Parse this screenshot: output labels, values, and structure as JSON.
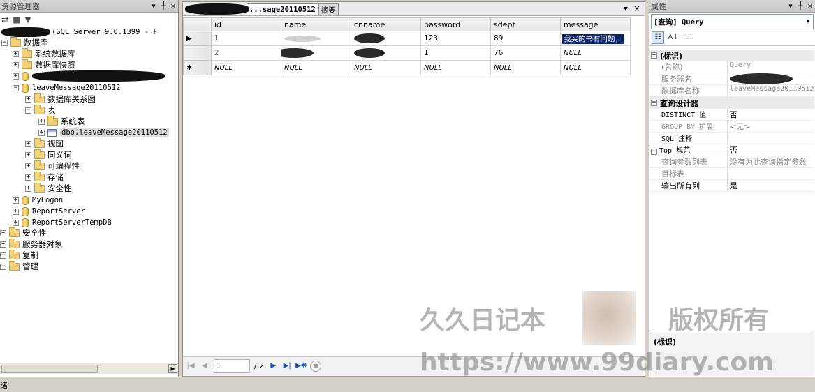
{
  "object_explorer": {
    "title": "资源管理器",
    "ctrl_pin": "▾ ╀",
    "ctrl_close": "×",
    "server_label": "(SQL Server 9.0.1399 - F",
    "tree": {
      "databases": "数据库",
      "system_databases": "系统数据库",
      "snapshots": "数据库快照",
      "db_main": "leaveMessage20110512",
      "diagrams": "数据库关系图",
      "tables": "表",
      "system_tables": "系统表",
      "table_item": "dbo.leaveMessage20110512",
      "views": "视图",
      "synonyms": "同义词",
      "programmability": "可编程性",
      "storage": "存储",
      "security_db": "安全性",
      "db_mylogon": "MyLogon",
      "db_reportserver": "ReportServer",
      "db_reportservertemp": "ReportServerTempDB",
      "security": "安全性",
      "server_objects": "服务器对象",
      "replication": "复制",
      "management": "管理"
    }
  },
  "query_window": {
    "tab_active": "...sage20110512",
    "tab_summary": "摘要",
    "columns": [
      "id",
      "name",
      "cnname",
      "password",
      "sdept",
      "message"
    ],
    "rows": [
      {
        "marker": "▶",
        "id": "1",
        "password": "123",
        "sdept": "89",
        "message": "我买的书有问题，"
      },
      {
        "marker": "",
        "id": "2",
        "password": "1",
        "sdept": "76",
        "message": "NULL"
      },
      {
        "marker": "✱",
        "id": "NULL",
        "name": "NULL",
        "cnname": "NULL",
        "password": "NULL",
        "sdept": "NULL",
        "message": "NULL"
      }
    ],
    "nav": {
      "page_value": "1",
      "page_total": "/ 2"
    }
  },
  "properties": {
    "title": "属性",
    "object_selector": "[查询] Query",
    "categories": {
      "identity": "(标识)",
      "query_designer": "查询设计器"
    },
    "rows": {
      "name_key": "(名称)",
      "name_val": "Query",
      "server_key": "服务器名",
      "dbname_key": "数据库名称",
      "dbname_val": "leaveMessage20110512",
      "distinct_key": "DISTINCT 值",
      "distinct_val": "否",
      "groupby_key": "GROUP BY 扩展",
      "groupby_val": "<无>",
      "sqlnote_key": "SQL 注释",
      "top_key": "Top 规范",
      "top_val": "否",
      "params_key": "查询参数列表",
      "params_val": "没有为此查询指定参数",
      "target_key": "目标表",
      "allcols_key": "输出所有列",
      "allcols_val": "是"
    },
    "description_title": "(标识)"
  },
  "watermark": {
    "left": "久久日记本",
    "right": "版权所有",
    "url": "https://www.99diary.com"
  },
  "status": {
    "text": "绪"
  }
}
